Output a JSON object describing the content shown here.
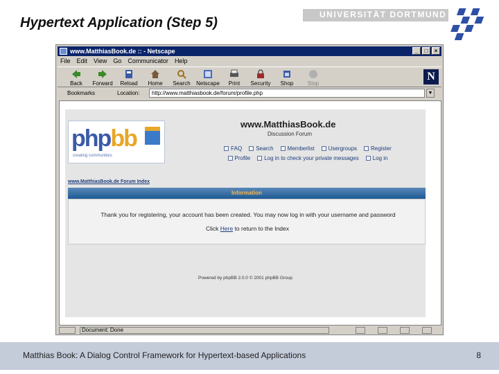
{
  "slide": {
    "title": "Hypertext Application (Step 5)",
    "university": "UNIVERSITÄT DORTMUND",
    "footer_text": "Matthias Book: A Dialog Control Framework for Hypertext-based Applications",
    "page_number": "8"
  },
  "browser": {
    "window_title": "www.MatthiasBook.de :: - Netscape",
    "window_buttons": [
      "_",
      "□",
      "×"
    ],
    "menu": [
      "File",
      "Edit",
      "View",
      "Go",
      "Communicator",
      "Help"
    ],
    "toolbar": [
      {
        "label": "Back",
        "icon": "back-arrow-icon"
      },
      {
        "label": "Forward",
        "icon": "forward-arrow-icon"
      },
      {
        "label": "Reload",
        "icon": "reload-icon"
      },
      {
        "label": "Home",
        "icon": "home-icon"
      },
      {
        "label": "Search",
        "icon": "search-icon"
      },
      {
        "label": "Netscape",
        "icon": "netscape-icon"
      },
      {
        "label": "Print",
        "icon": "print-icon"
      },
      {
        "label": "Security",
        "icon": "security-lock-icon"
      },
      {
        "label": "Shop",
        "icon": "shop-icon"
      },
      {
        "label": "Stop",
        "icon": "stop-icon"
      }
    ],
    "bookmarks_label": "Bookmarks",
    "location_label": "Location:",
    "location_url": "http://www.matthiasbook.de/forum/profile.php",
    "status_text": "Document: Done"
  },
  "page": {
    "logo_text_a": "php",
    "logo_text_b": "bb",
    "logo_tagline": "creating communities",
    "site_title": "www.MatthiasBook.de",
    "site_subtitle": "Discussion Forum",
    "links_row1": [
      "FAQ",
      "Search",
      "Memberlist",
      "Usergroups",
      "Register"
    ],
    "links_row2": [
      "Profile",
      "Log in to check your private messages",
      "Log in"
    ],
    "forum_index": "www.MatthiasBook.de Forum Index",
    "info_header": "Information",
    "message": "Thank you for registering, your account has been created. You may now log in with your username and password",
    "return_prefix": "Click ",
    "return_link": "Here",
    "return_suffix": " to return to the Index",
    "powered_by": "Powered by phpBB 2.0.0 © 2001 phpBB Group"
  },
  "colors": {
    "browser_chrome": "#d4d0c8",
    "titlebar": "#0a246a",
    "info_header_text": "#ffb848",
    "footer_band": "#c4ccda"
  }
}
